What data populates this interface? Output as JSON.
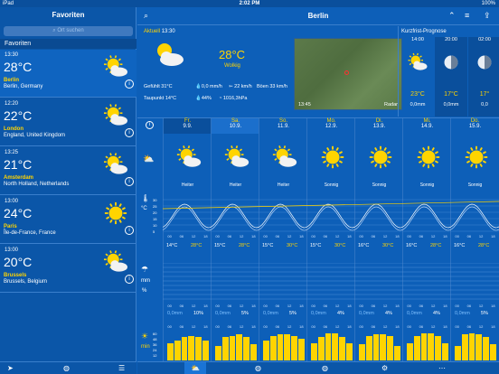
{
  "status": {
    "left": "iPad",
    "time": "2:02 PM",
    "battery": "100%"
  },
  "sidebar": {
    "title": "Favoriten",
    "search_placeholder": "Ort suchen",
    "section": "Favoriten",
    "locations": [
      {
        "time": "13:30",
        "temp": "28°C",
        "city": "Berlin",
        "country": "Berlin, Germany",
        "icon": "sun-cloud-icon"
      },
      {
        "time": "12:20",
        "temp": "22°C",
        "city": "London",
        "country": "England, United Kingdom",
        "icon": "sun-cloud-icon"
      },
      {
        "time": "13:25",
        "temp": "21°C",
        "city": "Amsterdam",
        "country": "North Holland, Netherlands",
        "icon": "sun-cloud-icon"
      },
      {
        "time": "13:00",
        "temp": "24°C",
        "city": "Paris",
        "country": "Île-de-France, France",
        "icon": "sun-icon"
      },
      {
        "time": "13:00",
        "temp": "20°C",
        "city": "Brussels",
        "country": "Brussels, Belgium",
        "icon": "sun-cloud-icon"
      }
    ]
  },
  "header": {
    "title": "Berlin"
  },
  "current": {
    "label": "Aktuell",
    "time": "13:30",
    "temp": "28°C",
    "condition": "Wolkig",
    "feels": "Gefühlt 31°C",
    "rain": "0,0 mm/h",
    "wind": "22 km/h",
    "gusts": "Böen 33 km/h",
    "dew": "Taupunkt 14°C",
    "humidity": "44%",
    "pressure": "1016,3hPa",
    "radar_time": "13:45",
    "radar_label": "Radar"
  },
  "kurzfrist": {
    "title": "Kurzfrist-Prognose",
    "cols": [
      {
        "time": "14:00",
        "temp": "23°C",
        "precip": "0,0mm",
        "icon": "sun-cloud-icon"
      },
      {
        "time": "20:00",
        "temp": "17°C",
        "precip": "0,0mm",
        "icon": "moon-icon"
      },
      {
        "time": "02:00",
        "temp": "17°",
        "precip": "0,0",
        "icon": "moon-icon"
      }
    ]
  },
  "days": [
    {
      "name": "Fr.",
      "date": "9.9.",
      "cond": "Heiter",
      "low": "14°C",
      "high": "28°C",
      "rain": "0,0mm",
      "pct": "10%",
      "icon": "sun-cloud-icon",
      "sun": [
        0.6,
        0.7,
        0.8,
        0.85,
        0.8,
        0.7
      ]
    },
    {
      "name": "Sa.",
      "date": "10.9.",
      "cond": "Heiter",
      "low": "15°C",
      "high": "28°C",
      "rain": "0,0mm",
      "pct": "5%",
      "icon": "sun-cloud-icon",
      "sun": [
        0.5,
        0.8,
        0.85,
        0.9,
        0.8,
        0.55
      ]
    },
    {
      "name": "So.",
      "date": "11.9.",
      "cond": "Heiter",
      "low": "15°C",
      "high": "30°C",
      "rain": "0,0mm",
      "pct": "5%",
      "icon": "sun-cloud-icon",
      "sun": [
        0.7,
        0.85,
        0.9,
        0.9,
        0.85,
        0.75
      ]
    },
    {
      "name": "Mo.",
      "date": "12.9.",
      "cond": "Sonnig",
      "low": "15°C",
      "high": "30°C",
      "rain": "0,0mm",
      "pct": "4%",
      "icon": "sun-icon",
      "sun": [
        0.6,
        0.8,
        0.95,
        0.95,
        0.8,
        0.6
      ]
    },
    {
      "name": "Di.",
      "date": "13.9.",
      "cond": "Sonnig",
      "low": "16°C",
      "high": "30°C",
      "rain": "0,0mm",
      "pct": "4%",
      "icon": "sun-icon",
      "sun": [
        0.55,
        0.85,
        0.9,
        0.9,
        0.85,
        0.5
      ]
    },
    {
      "name": "Mi.",
      "date": "14.9.",
      "cond": "Sonnig",
      "low": "16°C",
      "high": "28°C",
      "rain": "0,0mm",
      "pct": "4%",
      "icon": "sun-icon",
      "sun": [
        0.6,
        0.85,
        0.95,
        0.95,
        0.85,
        0.6
      ]
    },
    {
      "name": "Do.",
      "date": "15.9.",
      "cond": "Sonnig",
      "low": "16°C",
      "high": "28°C",
      "rain": "0,0mm",
      "pct": "5%",
      "icon": "sun-icon",
      "sun": [
        0.5,
        0.9,
        0.95,
        0.9,
        0.8,
        0.55
      ]
    }
  ],
  "hours": [
    "00",
    "06",
    "12",
    "18"
  ],
  "units": {
    "temp": "°C",
    "rain": "mm",
    "pct": "%",
    "sun": "min"
  },
  "axis": {
    "temp": [
      "30",
      "25",
      "20",
      "15",
      "10",
      "5"
    ],
    "sun": [
      "60",
      "48",
      "36",
      "24",
      "12"
    ]
  }
}
